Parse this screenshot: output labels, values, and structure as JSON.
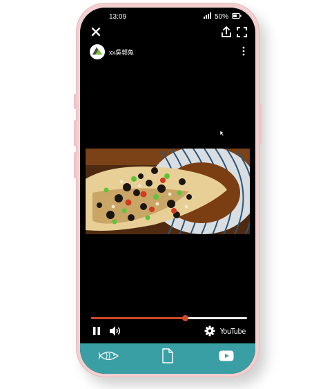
{
  "status_bar": {
    "time": "13:09",
    "battery_percent": "50%",
    "signal_icon": "signal-icon",
    "battery_icon": "battery-icon"
  },
  "player": {
    "close_icon": "close-icon",
    "share_icon": "share-icon",
    "fullscreen_icon": "fullscreen-icon",
    "more_icon": "more-vertical-icon",
    "channel": {
      "name": "xx吳郭魚",
      "avatar_icon": "channel-logo-icon"
    },
    "video": {
      "thumbnail_icon": "steamed-fish-thumbnail"
    },
    "progress": {
      "fraction": 0.6
    },
    "controls": {
      "pause_icon": "pause-icon",
      "volume_icon": "volume-icon",
      "settings_icon": "settings-gear-icon",
      "brand_label": "YouTube"
    }
  },
  "bottom_nav": {
    "items": [
      {
        "icon": "fish-icon"
      },
      {
        "icon": "document-icon"
      },
      {
        "icon": "youtube-play-icon"
      }
    ]
  },
  "colors": {
    "frame": "#f3cfcf",
    "screen": "#000000",
    "progress": "#d24a2a",
    "nav": "#3a9fa4"
  }
}
